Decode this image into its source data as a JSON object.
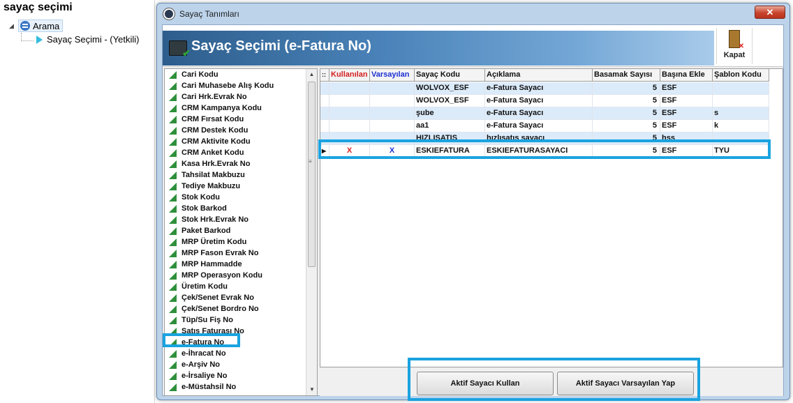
{
  "background": {
    "title": "sayaç seçimi",
    "tree_root": "Arama",
    "tree_child": "Sayaç Seçimi - (Yetkili)"
  },
  "dialog": {
    "window_title": "Sayaç Tanımları",
    "close_label": "✕",
    "header_title": "Sayaç Seçimi (e-Fatura No)",
    "kapat_label": "Kapat"
  },
  "counter_types": [
    "Cari Kodu",
    "Cari Muhasebe Alış Kodu",
    "Cari Hrk.Evrak No",
    "CRM Kampanya Kodu",
    "CRM Fırsat Kodu",
    "CRM Destek Kodu",
    "CRM Aktivite Kodu",
    "CRM Anket Kodu",
    "Kasa Hrk.Evrak No",
    "Tahsilat Makbuzu",
    "Tediye Makbuzu",
    "Stok Kodu",
    "Stok Barkod",
    "Stok Hrk.Evrak No",
    "Paket Barkod",
    "MRP Üretim Kodu",
    "MRP Fason Evrak No",
    "MRP Hammadde",
    "MRP Operasyon Kodu",
    "Üretim Kodu",
    "Çek/Senet Evrak No",
    "Çek/Senet Bordro No",
    "Tüp/Su Fiş No",
    "Satış Faturası No",
    "e-Fatura No",
    "e-İhracat No",
    "e-Arşiv No",
    "e-İrsaliye No",
    "e-Müstahsil No"
  ],
  "grid": {
    "columns": {
      "indicator": "::",
      "kullanilan": "Kullanılan",
      "varsayilan": "Varsayılan",
      "sayac_kodu": "Sayaç Kodu",
      "aciklama": "Açıklama",
      "basamak": "Basamak Sayısı",
      "basina_ekle": "Başına Ekle",
      "sablon": "Şablon Kodu"
    },
    "rows": [
      {
        "kullanilan": "",
        "varsayilan": "",
        "sayac_kodu": "WOLVOX_ESF",
        "aciklama": "e-Fatura Sayacı",
        "basamak": "5",
        "basina_ekle": "ESF",
        "sablon": ""
      },
      {
        "kullanilan": "",
        "varsayilan": "",
        "sayac_kodu": "WOLVOX_ESF",
        "aciklama": "e-Fatura Sayacı",
        "basamak": "5",
        "basina_ekle": "ESF",
        "sablon": ""
      },
      {
        "kullanilan": "",
        "varsayilan": "",
        "sayac_kodu": "şube",
        "aciklama": "e-Fatura Sayacı",
        "basamak": "5",
        "basina_ekle": "ESF",
        "sablon": "s"
      },
      {
        "kullanilan": "",
        "varsayilan": "",
        "sayac_kodu": "aa1",
        "aciklama": "e-Fatura Sayacı",
        "basamak": "5",
        "basina_ekle": "ESF",
        "sablon": "k"
      },
      {
        "kullanilan": "",
        "varsayilan": "",
        "sayac_kodu": "HIZLISATIS",
        "aciklama": "hızlısatış sayacı",
        "basamak": "5",
        "basina_ekle": "hss",
        "sablon": ""
      },
      {
        "kullanilan": "X",
        "varsayilan": "X",
        "sayac_kodu": "ESKIEFATURA",
        "aciklama": "ESKIEFATURASAYACI",
        "basamak": "5",
        "basina_ekle": "ESF",
        "sablon": "TYU"
      }
    ]
  },
  "buttons": {
    "use": "Aktif Sayacı Kullan",
    "default": "Aktif Sayacı Varsayılan Yap"
  },
  "colors": {
    "kullanilan_header": "#d42020",
    "varsayilan_header": "#1a2fd4",
    "highlight": "#1aa3e0"
  }
}
